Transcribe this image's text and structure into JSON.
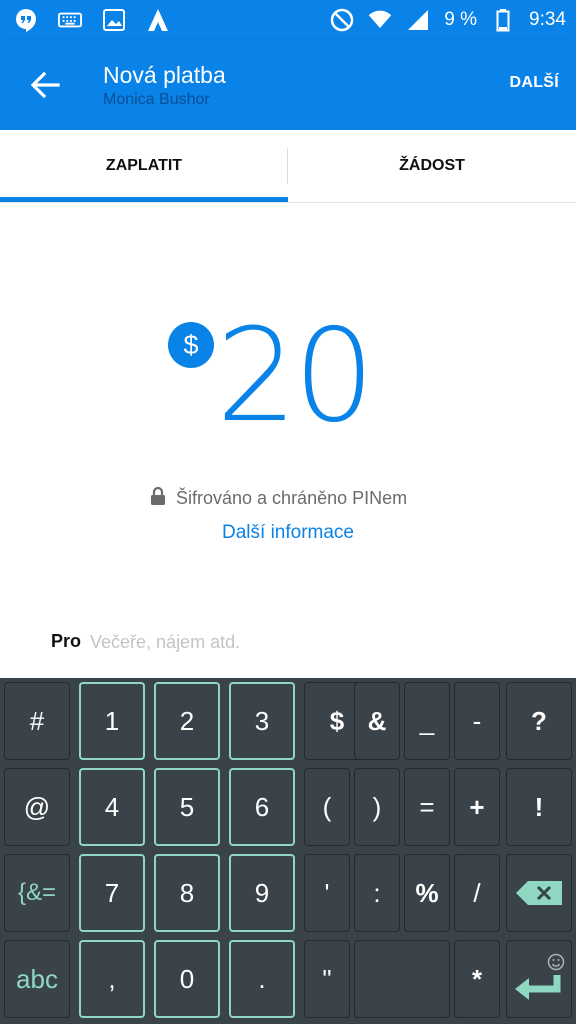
{
  "status_bar": {
    "battery": "9 %",
    "time": "9:34",
    "left_icons": [
      "hangouts-icon",
      "keyboard-icon",
      "image-icon",
      "app-logo-icon"
    ],
    "right_icons": [
      "do-not-disturb-icon",
      "wifi-icon",
      "signal-icon",
      "battery-icon"
    ]
  },
  "header": {
    "title": "Nová platba",
    "subtitle": "Monica Bushor",
    "next_label": "DALŠÍ"
  },
  "tabs": [
    {
      "label": "ZAPLATIT",
      "active": true
    },
    {
      "label": "ŽÁDOST",
      "active": false
    }
  ],
  "payment": {
    "currency_symbol": "$",
    "amount": "20",
    "security_text": "Šifrováno a chráněno PINem",
    "more_info": "Další informace"
  },
  "note": {
    "label": "Pro",
    "placeholder": "Večeře, nájem atd."
  },
  "keyboard": {
    "rows": [
      [
        "#",
        "1",
        "2",
        "3",
        "$",
        "&",
        "_",
        "-",
        "?"
      ],
      [
        "@",
        "4",
        "5",
        "6",
        "(",
        ")",
        "=",
        "+",
        "!"
      ],
      [
        "{&=",
        "7",
        "8",
        "9",
        "'",
        ":",
        "%",
        "/",
        ""
      ],
      [
        "abc",
        ",",
        "0",
        ".",
        "\"",
        "",
        "",
        "*",
        ""
      ]
    ]
  },
  "colors": {
    "primary": "#0a83e8",
    "keyboard_bg": "#3a4349",
    "keyboard_accent": "#8fd6c3"
  }
}
